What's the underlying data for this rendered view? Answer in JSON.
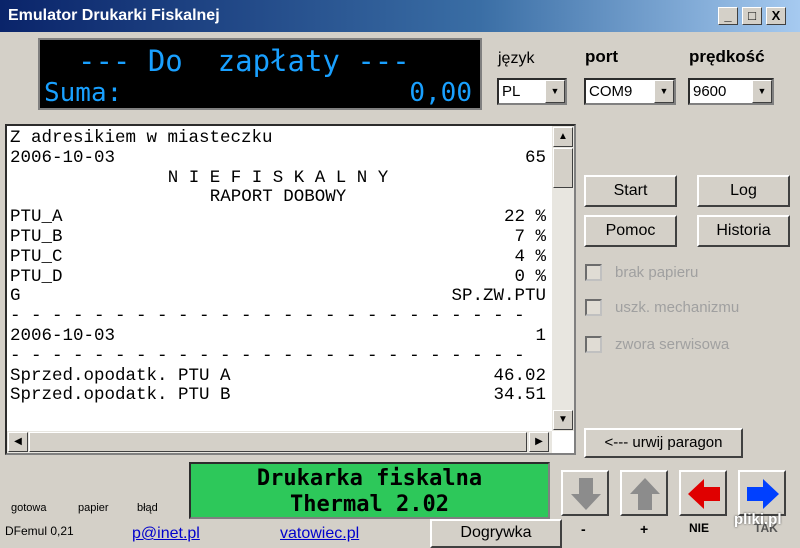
{
  "window": {
    "title": "Emulator Drukarki Fiskalnej",
    "min": "_",
    "max": "□",
    "close": "X"
  },
  "display": {
    "line1": "--- Do  zapłaty ---",
    "sum_label": "Suma:",
    "sum_value": "0,00"
  },
  "settings": {
    "language_label": "język",
    "language_value": "PL",
    "port_label": "port",
    "port_value": "COM9",
    "speed_label": "prędkość",
    "speed_value": "9600"
  },
  "receipt": {
    "lines": [
      {
        "l": "Z adresikiem w miasteczku",
        "r": ""
      },
      {
        "l": "2006-10-03",
        "r": "65"
      },
      {
        "c": "N I E F I S K A L N Y"
      },
      {
        "c": "RAPORT DOBOWY"
      },
      {
        "l": "PTU_A",
        "r": "22 %"
      },
      {
        "l": "PTU_B",
        "r": "7 %"
      },
      {
        "l": "PTU_C",
        "r": "4 %"
      },
      {
        "l": "PTU_D",
        "r": "0 %"
      },
      {
        "l": "G",
        "r": "SP.ZW.PTU"
      },
      {
        "l": "- - - - - - - - - - - - - - - - - - - - - - - - -",
        "r": ""
      },
      {
        "l": "2006-10-03",
        "r": "1"
      },
      {
        "l": "- - - - - - - - - - - - - - - - - - - - - - - - -",
        "r": ""
      },
      {
        "l": "Sprzed.opodatk. PTU A",
        "r": "46.02"
      },
      {
        "l": "Sprzed.opodatk. PTU B",
        "r": "34.51"
      }
    ]
  },
  "buttons": {
    "start": "Start",
    "log": "Log",
    "help": "Pomoc",
    "history": "Historia",
    "cancel_receipt": "<--- urwij paragon",
    "reload": "Dogrywka"
  },
  "checks": {
    "no_paper": "brak papieru",
    "mech_fault": "uszk. mechanizmu",
    "service_jumper": "zwora serwisowa"
  },
  "printer": {
    "line1": "Drukarka fiskalna",
    "line2": "Thermal 2.02"
  },
  "status": {
    "ready": "gotowa",
    "paper": "papier",
    "error": "błąd",
    "version": "DFemul 0,21"
  },
  "links": {
    "email": "p@inet.pl",
    "site": "vatowiec.pl"
  },
  "arrows": {
    "minus": "-",
    "plus": "+",
    "no": "NIE",
    "yes": "TAK"
  },
  "colors": {
    "lcd_text": "#19a0ff",
    "printer_bg": "#2dc85a",
    "no_arrow": "#e00000",
    "yes_arrow": "#0040ff"
  },
  "watermark": "pliki.pl"
}
